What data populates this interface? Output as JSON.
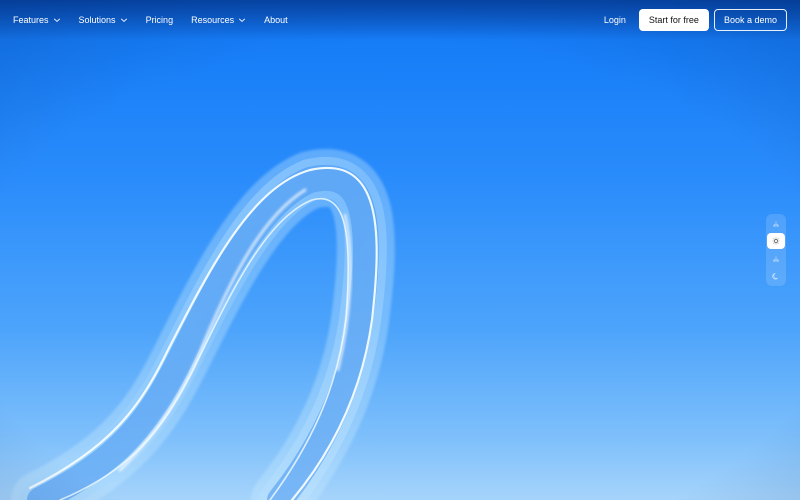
{
  "nav": {
    "items": [
      {
        "label": "Features",
        "has_dropdown": true
      },
      {
        "label": "Solutions",
        "has_dropdown": true
      },
      {
        "label": "Pricing",
        "has_dropdown": false
      },
      {
        "label": "Resources",
        "has_dropdown": true
      },
      {
        "label": "About",
        "has_dropdown": false
      }
    ],
    "login_label": "Login",
    "primary_cta": "Start for free",
    "secondary_cta": "Book a demo"
  },
  "theme_switcher": {
    "options": [
      {
        "icon": "sunrise-icon",
        "active": false
      },
      {
        "icon": "sun-icon",
        "active": true
      },
      {
        "icon": "sunset-icon",
        "active": false
      },
      {
        "icon": "moon-icon",
        "active": false
      }
    ]
  },
  "colors": {
    "background_top": "#0a5fd8",
    "background_mid": "#2a8cfb",
    "background_bottom": "#a6d4fb",
    "primary_button_bg": "#ffffff",
    "primary_button_text": "#111111"
  }
}
